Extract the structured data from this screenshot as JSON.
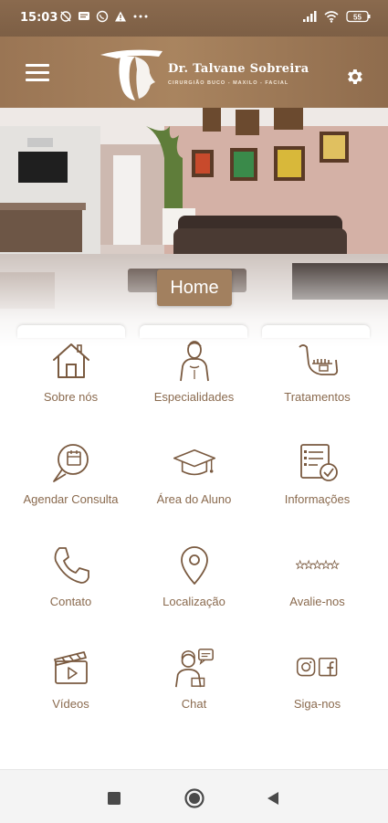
{
  "status_bar": {
    "time": "15:03",
    "battery": "55",
    "left_icons": [
      "no-disturb-icon",
      "message-icon",
      "whatsapp-icon",
      "warning-icon",
      "more-dots-icon"
    ],
    "right_icons": [
      "signal-icon",
      "wifi-icon",
      "battery-icon"
    ]
  },
  "app_bar": {
    "brand_title": "Dr. Talvane Sobreira",
    "brand_subtitle": "CIRURGIÃO BUCO - MAXILO - FACIAL",
    "menu_icon": "hamburger-menu-icon",
    "settings_icon": "gear-icon"
  },
  "hero": {
    "badge": "Home"
  },
  "menu_items": [
    {
      "label": "Sobre nós",
      "icon": "house-icon"
    },
    {
      "label": "Especialidades",
      "icon": "person-icon"
    },
    {
      "label": "Tratamentos",
      "icon": "jaw-icon"
    },
    {
      "label": "Agendar Consulta",
      "icon": "calendar-chat-icon"
    },
    {
      "label": "Área do Aluno",
      "icon": "graduation-cap-icon"
    },
    {
      "label": "Informações",
      "icon": "checklist-icon"
    },
    {
      "label": "Contato",
      "icon": "phone-icon"
    },
    {
      "label": "Localização",
      "icon": "location-pin-icon"
    },
    {
      "label": "Avalie-nos",
      "icon": "stars-icon"
    },
    {
      "label": "Vídeos",
      "icon": "clapperboard-icon"
    },
    {
      "label": "Chat",
      "icon": "chat-person-icon"
    },
    {
      "label": "Siga-nos",
      "icon": "instagram-facebook-icon"
    }
  ],
  "colors": {
    "brand": "#a2805f",
    "label": "#8a6a4e",
    "icon_stroke": "#7a5a40"
  },
  "nav_bar": {
    "buttons": [
      "recents-square-icon",
      "home-circle-icon",
      "back-triangle-icon"
    ]
  }
}
